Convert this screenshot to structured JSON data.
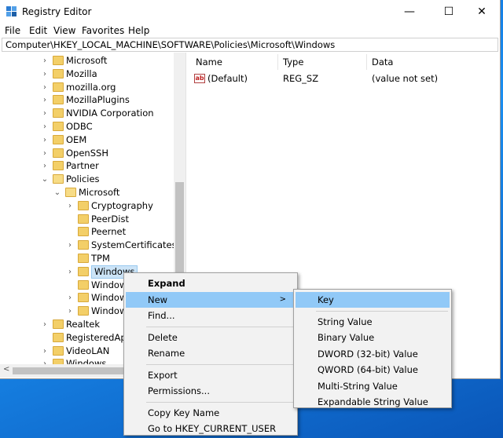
{
  "window": {
    "title": "Registry Editor",
    "controls": {
      "minimize": "—",
      "maximize": "☐",
      "close": "✕"
    }
  },
  "menubar": [
    "File",
    "Edit",
    "View",
    "Favorites",
    "Help"
  ],
  "address": "Computer\\HKEY_LOCAL_MACHINE\\SOFTWARE\\Policies\\Microsoft\\Windows",
  "tree": [
    {
      "label": "Microsoft",
      "level": 0,
      "chev": ">"
    },
    {
      "label": "Mozilla",
      "level": 0,
      "chev": ">"
    },
    {
      "label": "mozilla.org",
      "level": 0,
      "chev": ">"
    },
    {
      "label": "MozillaPlugins",
      "level": 0,
      "chev": ">"
    },
    {
      "label": "NVIDIA Corporation",
      "level": 0,
      "chev": ">"
    },
    {
      "label": "ODBC",
      "level": 0,
      "chev": ">"
    },
    {
      "label": "OEM",
      "level": 0,
      "chev": ">"
    },
    {
      "label": "OpenSSH",
      "level": 0,
      "chev": ">"
    },
    {
      "label": "Partner",
      "level": 0,
      "chev": ">"
    },
    {
      "label": "Policies",
      "level": 0,
      "chev": "v"
    },
    {
      "label": "Microsoft",
      "level": 1,
      "chev": "v"
    },
    {
      "label": "Cryptography",
      "level": 2,
      "chev": ">"
    },
    {
      "label": "PeerDist",
      "level": 2,
      "chev": ""
    },
    {
      "label": "Peernet",
      "level": 2,
      "chev": ""
    },
    {
      "label": "SystemCertificates",
      "level": 2,
      "chev": ">"
    },
    {
      "label": "TPM",
      "level": 2,
      "chev": ""
    },
    {
      "label": "Windows",
      "level": 2,
      "chev": ">",
      "selected": true
    },
    {
      "label": "Window",
      "level": 2,
      "chev": ""
    },
    {
      "label": "Window",
      "level": 2,
      "chev": ">"
    },
    {
      "label": "Window",
      "level": 2,
      "chev": ">"
    },
    {
      "label": "Realtek",
      "level": 0,
      "chev": ">"
    },
    {
      "label": "RegisteredApp",
      "level": 0,
      "chev": ""
    },
    {
      "label": "VideoLAN",
      "level": 0,
      "chev": ">"
    },
    {
      "label": "Windows",
      "level": 0,
      "chev": ">"
    }
  ],
  "list": {
    "headers": [
      "Name",
      "Type",
      "Data"
    ],
    "rows": [
      {
        "name": "(Default)",
        "type": "REG_SZ",
        "data": "(value not set)",
        "icon": "ab"
      }
    ]
  },
  "context_menu": {
    "items": [
      {
        "label": "Expand",
        "bold": true
      },
      {
        "label": "New",
        "submenu": true,
        "highlight": true
      },
      {
        "label": "Find..."
      },
      {
        "sep": true
      },
      {
        "label": "Delete"
      },
      {
        "label": "Rename"
      },
      {
        "sep": true
      },
      {
        "label": "Export"
      },
      {
        "label": "Permissions..."
      },
      {
        "sep": true
      },
      {
        "label": "Copy Key Name"
      },
      {
        "label": "Go to HKEY_CURRENT_USER"
      }
    ],
    "arrow": ">"
  },
  "submenu": {
    "items": [
      {
        "label": "Key",
        "highlight": true
      },
      {
        "sep": true
      },
      {
        "label": "String Value"
      },
      {
        "label": "Binary Value"
      },
      {
        "label": "DWORD (32-bit) Value"
      },
      {
        "label": "QWORD (64-bit) Value"
      },
      {
        "label": "Multi-String Value"
      },
      {
        "label": "Expandable String Value"
      }
    ]
  },
  "colors": {
    "highlight": "#91c9f7",
    "selection": "#cce4f7",
    "folder": "#f3cf68",
    "desktop": "#1a8ef0"
  }
}
